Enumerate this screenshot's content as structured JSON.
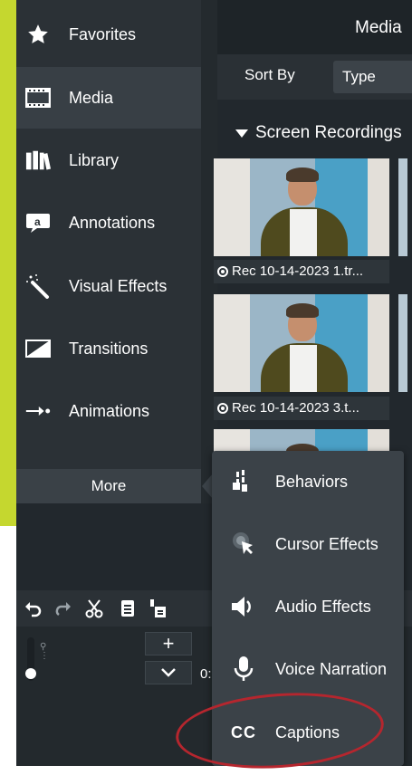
{
  "colors": {
    "accent": "#c5d72f",
    "highlight_circle": "#b5262e"
  },
  "sidebar": {
    "items": [
      {
        "label": "Favorites",
        "icon": "star-icon"
      },
      {
        "label": "Media",
        "icon": "film-icon"
      },
      {
        "label": "Library",
        "icon": "library-icon"
      },
      {
        "label": "Annotations",
        "icon": "annotation-icon"
      },
      {
        "label": "Visual Effects",
        "icon": "magic-wand-icon"
      },
      {
        "label": "Transitions",
        "icon": "transition-icon"
      },
      {
        "label": "Animations",
        "icon": "animation-arrow-icon"
      }
    ],
    "more_label": "More"
  },
  "media": {
    "header": "Media",
    "sort_label": "Sort By",
    "sort_value": "Type",
    "group_label": "Screen Recordings",
    "clips": [
      {
        "label": "Rec 10-14-2023 1.tr..."
      },
      {
        "label": "Rec 10-14-2023 3.t..."
      }
    ]
  },
  "timeline": {
    "time": "0:"
  },
  "more_menu": {
    "items": [
      {
        "label": "Behaviors",
        "icon": "behaviors-icon"
      },
      {
        "label": "Cursor Effects",
        "icon": "cursor-effects-icon"
      },
      {
        "label": "Audio Effects",
        "icon": "speaker-icon"
      },
      {
        "label": "Voice Narration",
        "icon": "microphone-icon"
      },
      {
        "label": "Captions",
        "icon": "cc-icon",
        "icon_text": "CC"
      }
    ]
  }
}
